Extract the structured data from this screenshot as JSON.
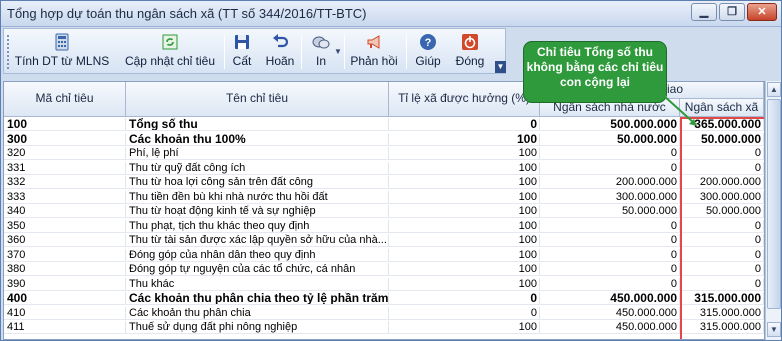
{
  "window": {
    "title": "Tổng hợp dự toán thu ngân sách xã (TT số 344/2016/TT-BTC)",
    "controls": {
      "minimize_icon": "minimize-icon",
      "restore_icon": "restore-icon",
      "close_icon": "close-icon"
    }
  },
  "toolbar": {
    "buttons": [
      {
        "label": "Tính DT từ MLNS",
        "icon": "calculator-icon",
        "color": "#3a66b0"
      },
      {
        "label": "Cập nhật chỉ tiêu",
        "icon": "refresh-icon",
        "color": "#2f9a37"
      },
      {
        "label": "Cất",
        "icon": "save-icon",
        "color": "#2f56a6"
      },
      {
        "label": "Hoãn",
        "icon": "undo-icon",
        "color": "#2f56a6"
      },
      {
        "label": "In",
        "icon": "printer-icon",
        "color": "#4b5f84"
      },
      {
        "label": "Phản hồi",
        "icon": "megaphone-icon",
        "color": "#d2482a"
      },
      {
        "label": "Giúp",
        "icon": "help-icon",
        "color": "#2f56a6"
      },
      {
        "label": "Đóng",
        "icon": "power-icon",
        "color": "#d2482a"
      }
    ]
  },
  "callout": {
    "text": "Chỉ tiêu Tổng số thu không bằng các chỉ tiêu con cộng lại",
    "color": "#2e9a3c"
  },
  "grid": {
    "headers": {
      "code": "Mã chỉ tiêu",
      "name": "Tên chỉ tiêu",
      "rate": "Tỉ lệ xã được hưởng (%)",
      "group_partial": "giao",
      "state_budget": "Ngân sách nhà nước",
      "commune_budget": "Ngân sách xã"
    },
    "rows": [
      {
        "code": "100",
        "name": "Tổng số thu",
        "rate": "0",
        "state": "500.000.000",
        "commune": "365.000.000",
        "bold": true
      },
      {
        "code": "300",
        "name": "Các khoản thu 100%",
        "rate": "100",
        "state": "50.000.000",
        "commune": "50.000.000",
        "bold": true
      },
      {
        "code": "320",
        "name": "Phí, lệ phí",
        "rate": "100",
        "state": "0",
        "commune": "0",
        "bold": false
      },
      {
        "code": "331",
        "name": "Thu từ quỹ đất công ích",
        "rate": "100",
        "state": "0",
        "commune": "0",
        "bold": false
      },
      {
        "code": "332",
        "name": "Thu từ hoa lợi công sản trên đất công",
        "rate": "100",
        "state": "200.000.000",
        "commune": "200.000.000",
        "bold": false
      },
      {
        "code": "333",
        "name": "Thu tiền đền bù khi nhà nước thu hồi đất",
        "rate": "100",
        "state": "300.000.000",
        "commune": "300.000.000",
        "bold": false
      },
      {
        "code": "340",
        "name": "Thu từ hoạt động kinh tế và sự nghiệp",
        "rate": "100",
        "state": "50.000.000",
        "commune": "50.000.000",
        "bold": false
      },
      {
        "code": "350",
        "name": "Thu phạt, tịch thu khác theo quy định",
        "rate": "100",
        "state": "0",
        "commune": "0",
        "bold": false
      },
      {
        "code": "360",
        "name": "Thu từ tài sản được xác lập quyền sở hữu của nhà...",
        "rate": "100",
        "state": "0",
        "commune": "0",
        "bold": false
      },
      {
        "code": "370",
        "name": "Đóng góp của nhân dân theo quy định",
        "rate": "100",
        "state": "0",
        "commune": "0",
        "bold": false
      },
      {
        "code": "380",
        "name": "Đóng góp tự nguyện của các tổ chức, cá nhân",
        "rate": "100",
        "state": "0",
        "commune": "0",
        "bold": false
      },
      {
        "code": "390",
        "name": "Thu khác",
        "rate": "100",
        "state": "0",
        "commune": "0",
        "bold": false
      },
      {
        "code": "400",
        "name": "Các khoản thu phân chia theo tỷ lệ phần trăm (...",
        "rate": "0",
        "state": "450.000.000",
        "commune": "315.000.000",
        "bold": true
      },
      {
        "code": "410",
        "name": "Các khoản thu phân chia",
        "rate": "0",
        "state": "450.000.000",
        "commune": "315.000.000",
        "bold": false
      },
      {
        "code": "411",
        "name": "Thuế sử dụng đất phi nông nghiệp",
        "rate": "100",
        "state": "450.000.000",
        "commune": "315.000.000",
        "bold": false
      }
    ],
    "highlight_color": "#e24848"
  }
}
